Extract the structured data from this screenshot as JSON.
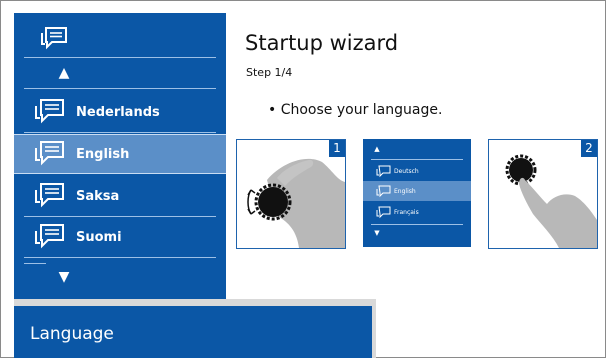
{
  "sidebar": {
    "languages": [
      {
        "label": "Nederlands"
      },
      {
        "label": "English"
      },
      {
        "label": "Saksa"
      },
      {
        "label": "Suomi"
      }
    ]
  },
  "header": {
    "title": "Startup wizard",
    "step": "Step 1/4"
  },
  "instruction": "• Choose your language.",
  "illustrations": {
    "card1_number": "1",
    "card2_number": "2",
    "mini_list": [
      {
        "label": "Deutsch"
      },
      {
        "label": "English"
      },
      {
        "label": "Français"
      }
    ]
  },
  "bottom_bar": {
    "label": "Language"
  },
  "colors": {
    "primary": "#0b57a6",
    "selected": "#5b8fc8",
    "separator": "#9dc0e6"
  },
  "icons": {
    "language": "speech-bubble-icon",
    "up": "arrow-up-icon",
    "down": "arrow-down-icon"
  }
}
